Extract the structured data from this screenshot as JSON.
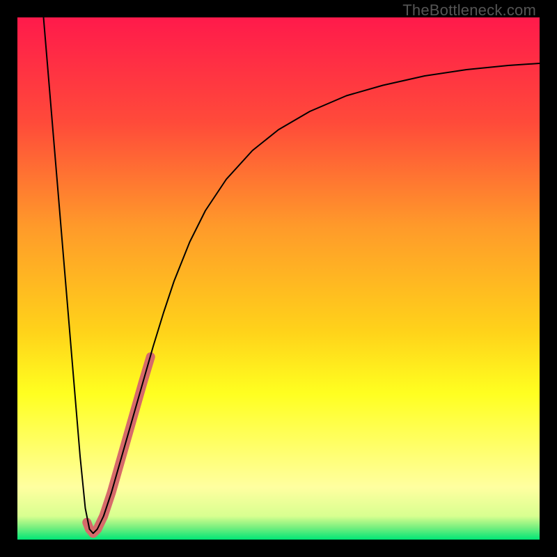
{
  "watermark": "TheBottleneck.com",
  "chart_data": {
    "type": "line",
    "title": "",
    "xlabel": "",
    "ylabel": "",
    "xlim": [
      0,
      100
    ],
    "ylim": [
      0,
      100
    ],
    "background_gradient": {
      "stops": [
        {
          "offset": 0.0,
          "color": "#ff1a4b"
        },
        {
          "offset": 0.2,
          "color": "#ff4a3a"
        },
        {
          "offset": 0.4,
          "color": "#ff9a2a"
        },
        {
          "offset": 0.6,
          "color": "#ffd21a"
        },
        {
          "offset": 0.72,
          "color": "#ffff20"
        },
        {
          "offset": 0.9,
          "color": "#ffffa0"
        },
        {
          "offset": 0.955,
          "color": "#d8ff90"
        },
        {
          "offset": 0.975,
          "color": "#80f080"
        },
        {
          "offset": 1.0,
          "color": "#00e676"
        }
      ]
    },
    "series": [
      {
        "name": "bottleneck-curve",
        "stroke": "#000000",
        "stroke_width": 2,
        "points": [
          {
            "x": 5.0,
            "y": 100.0
          },
          {
            "x": 6.0,
            "y": 88.0
          },
          {
            "x": 7.0,
            "y": 76.0
          },
          {
            "x": 8.0,
            "y": 64.0
          },
          {
            "x": 9.0,
            "y": 52.0
          },
          {
            "x": 10.0,
            "y": 40.0
          },
          {
            "x": 11.0,
            "y": 28.0
          },
          {
            "x": 12.0,
            "y": 16.0
          },
          {
            "x": 13.0,
            "y": 6.0
          },
          {
            "x": 13.8,
            "y": 2.0
          },
          {
            "x": 14.5,
            "y": 1.2
          },
          {
            "x": 15.3,
            "y": 2.0
          },
          {
            "x": 16.5,
            "y": 4.5
          },
          {
            "x": 18.0,
            "y": 9.0
          },
          {
            "x": 20.0,
            "y": 16.0
          },
          {
            "x": 22.0,
            "y": 23.0
          },
          {
            "x": 24.0,
            "y": 30.0
          },
          {
            "x": 26.0,
            "y": 37.0
          },
          {
            "x": 28.0,
            "y": 43.5
          },
          {
            "x": 30.0,
            "y": 49.5
          },
          {
            "x": 33.0,
            "y": 57.0
          },
          {
            "x": 36.0,
            "y": 63.0
          },
          {
            "x": 40.0,
            "y": 69.0
          },
          {
            "x": 45.0,
            "y": 74.5
          },
          {
            "x": 50.0,
            "y": 78.5
          },
          {
            "x": 56.0,
            "y": 82.0
          },
          {
            "x": 63.0,
            "y": 85.0
          },
          {
            "x": 70.0,
            "y": 87.0
          },
          {
            "x": 78.0,
            "y": 88.8
          },
          {
            "x": 86.0,
            "y": 90.0
          },
          {
            "x": 94.0,
            "y": 90.8
          },
          {
            "x": 100.0,
            "y": 91.2
          }
        ]
      },
      {
        "name": "highlight-band",
        "stroke": "#d66a6a",
        "stroke_width": 13,
        "linecap": "round",
        "points": [
          {
            "x": 14.5,
            "y": 1.2
          },
          {
            "x": 15.3,
            "y": 2.0
          },
          {
            "x": 16.5,
            "y": 4.5
          },
          {
            "x": 18.0,
            "y": 9.0
          },
          {
            "x": 20.0,
            "y": 16.0
          },
          {
            "x": 22.0,
            "y": 23.0
          },
          {
            "x": 24.0,
            "y": 30.0
          },
          {
            "x": 25.5,
            "y": 35.0
          }
        ]
      },
      {
        "name": "highlight-hook",
        "stroke": "#d66a6a",
        "stroke_width": 13,
        "linecap": "round",
        "points": [
          {
            "x": 13.3,
            "y": 3.3
          },
          {
            "x": 13.8,
            "y": 2.0
          },
          {
            "x": 14.5,
            "y": 1.2
          },
          {
            "x": 15.3,
            "y": 2.0
          }
        ]
      }
    ]
  }
}
